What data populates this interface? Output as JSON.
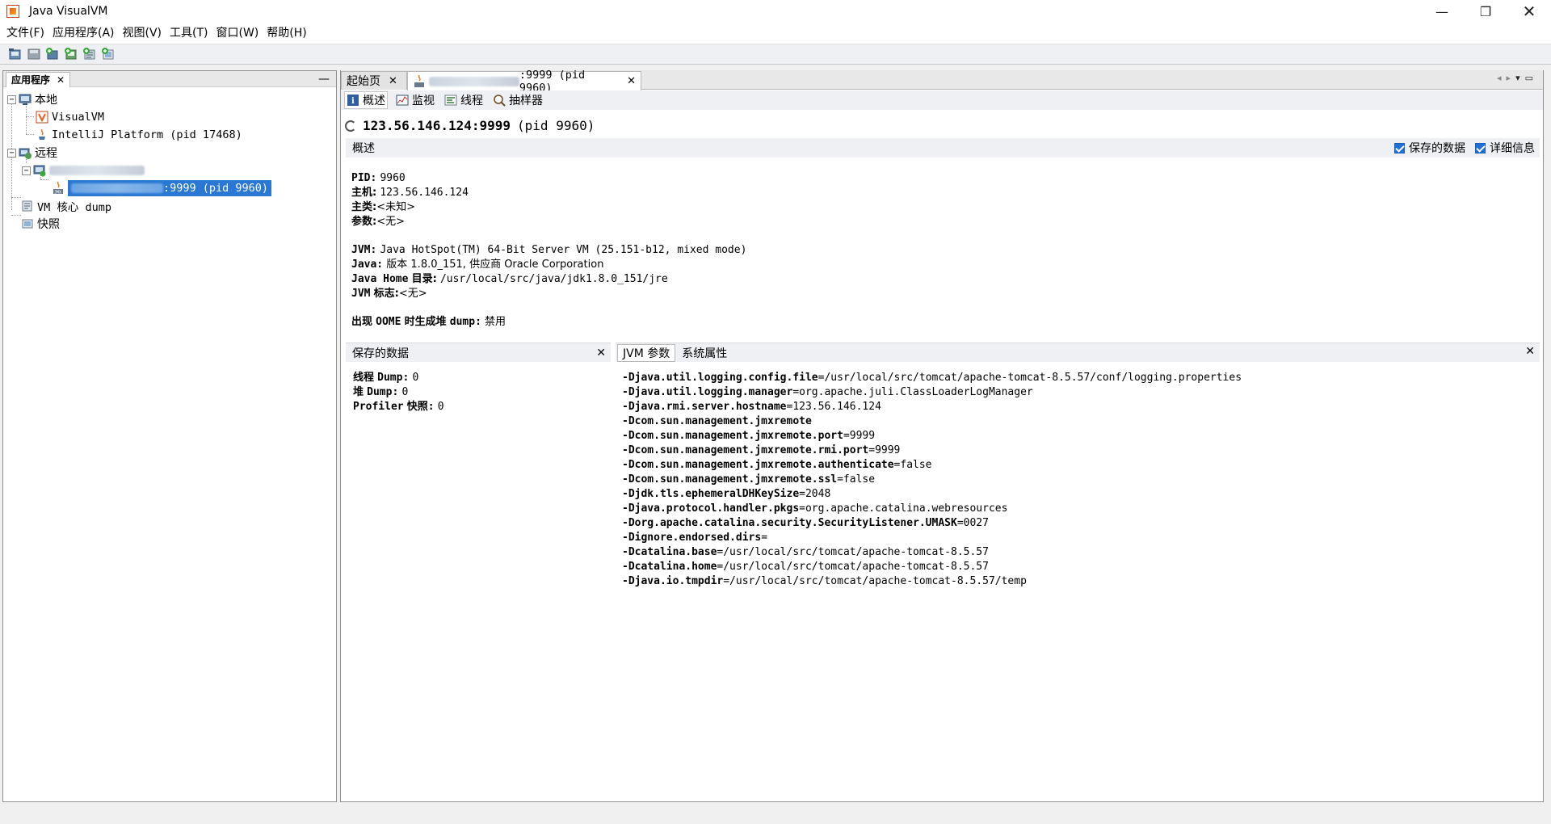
{
  "window": {
    "title": "Java VisualVM",
    "minimize": "—",
    "maximize": "❐",
    "close": "✕"
  },
  "menu": [
    "文件(F)",
    "应用程序(A)",
    "视图(V)",
    "工具(T)",
    "窗口(W)",
    "帮助(H)"
  ],
  "toolbar": {
    "icons": [
      "open-snapshot-icon",
      "save-icon",
      "add-jmx-icon",
      "add-remote-host-icon",
      "add-core-dump-icon",
      "add-snapshot-icon"
    ]
  },
  "left_panel": {
    "tab": "应用程序",
    "close": "✕",
    "minimize": "—",
    "tree": {
      "local": "本地",
      "visualvm": "VisualVM",
      "intellij": "IntelliJ Platform (pid 17468)",
      "remote": "远程",
      "selected_suffix": ":9999 (pid 9960)",
      "vm_core_dump": "VM 核心 dump",
      "snapshots": "快照",
      "expand": "−"
    }
  },
  "right_panel": {
    "tabs": {
      "start": "起始页",
      "app_suffix": ":9999 (pid 9960)",
      "close": "✕"
    },
    "tab_nav": {
      "left": "◂",
      "right": "▸",
      "menu": "▾",
      "restore": "▭"
    },
    "subtabs": [
      "概述",
      "监视",
      "线程",
      "抽样器"
    ],
    "app_title": {
      "host": "123.56.146.124:9999",
      "pid": "(pid 9960)"
    },
    "overview_label": "概述",
    "checkboxes": {
      "saved": "保存的数据",
      "details": "详细信息"
    },
    "info": {
      "pid_k": "PID:",
      "pid_v": "9960",
      "host_k": "主机:",
      "host_v": "123.56.146.124",
      "class_k": "主类:",
      "class_v": "<未知>",
      "args_k": "参数:",
      "args_v": "<无>",
      "jvm_k": "JVM:",
      "jvm_v": "Java HotSpot(TM) 64-Bit Server VM (25.151-b12, mixed mode)",
      "java_k": "Java:",
      "java_v": "版本 1.8.0_151, 供应商 Oracle Corporation",
      "home_k1": "Java Home",
      "home_k2": "目录:",
      "home_v": "/usr/local/src/java/jdk1.8.0_151/jre",
      "flags_k1": "JVM",
      "flags_k2": "标志:",
      "flags_v": "<无>",
      "oome_k1": "出现",
      "oome_k2": "OOME",
      "oome_k3": "时生成堆",
      "oome_k4": "dump:",
      "oome_v": "禁用"
    },
    "saved_data": {
      "title": "保存的数据",
      "close": "✕",
      "thread_k1": "线程",
      "thread_k2": "Dump:",
      "thread_v": "0",
      "heap_k1": "堆",
      "heap_k2": "Dump:",
      "heap_v": "0",
      "profiler_k1": "Profiler",
      "profiler_k2": "快照:",
      "profiler_v": "0"
    },
    "jvm_panel": {
      "tab_args": "JVM 参数",
      "tab_sys": "系统属性",
      "close": "✕",
      "args": [
        {
          "k": "-Djava.util.logging.config.file",
          "v": "=/usr/local/src/tomcat/apache-tomcat-8.5.57/conf/logging.properties"
        },
        {
          "k": "-Djava.util.logging.manager",
          "v": "=org.apache.juli.ClassLoaderLogManager"
        },
        {
          "k": "-Djava.rmi.server.hostname",
          "v": "=123.56.146.124"
        },
        {
          "k": "-Dcom.sun.management.jmxremote",
          "v": ""
        },
        {
          "k": "-Dcom.sun.management.jmxremote.port",
          "v": "=9999"
        },
        {
          "k": "-Dcom.sun.management.jmxremote.rmi.port",
          "v": "=9999"
        },
        {
          "k": "-Dcom.sun.management.jmxremote.authenticate",
          "v": "=false"
        },
        {
          "k": "-Dcom.sun.management.jmxremote.ssl",
          "v": "=false"
        },
        {
          "k": "-Djdk.tls.ephemeralDHKeySize",
          "v": "=2048"
        },
        {
          "k": "-Djava.protocol.handler.pkgs",
          "v": "=org.apache.catalina.webresources"
        },
        {
          "k": "-Dorg.apache.catalina.security.SecurityListener.UMASK",
          "v": "=0027"
        },
        {
          "k": "-Dignore.endorsed.dirs",
          "v": "="
        },
        {
          "k": "-Dcatalina.base",
          "v": "=/usr/local/src/tomcat/apache-tomcat-8.5.57"
        },
        {
          "k": "-Dcatalina.home",
          "v": "=/usr/local/src/tomcat/apache-tomcat-8.5.57"
        },
        {
          "k": "-Djava.io.tmpdir",
          "v": "=/usr/local/src/tomcat/apache-tomcat-8.5.57/temp"
        }
      ]
    }
  }
}
